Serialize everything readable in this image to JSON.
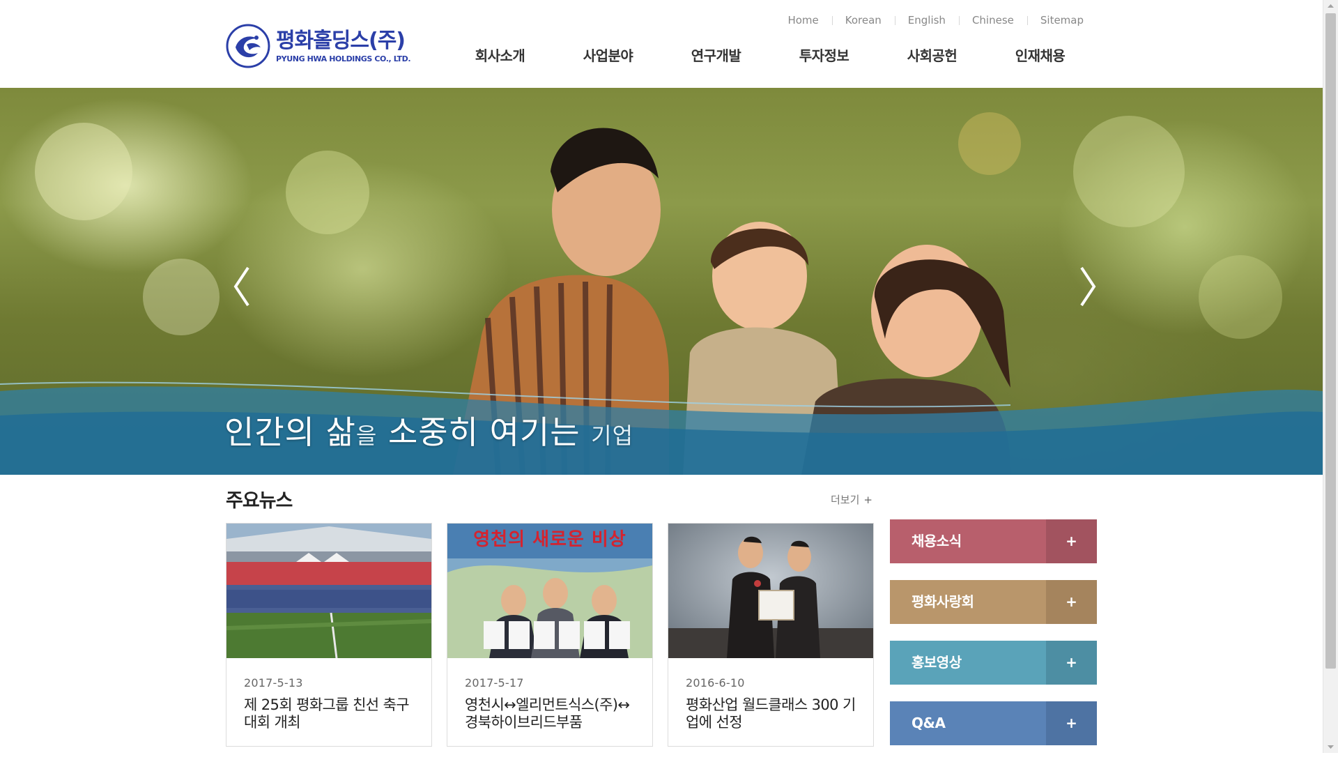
{
  "header": {
    "logo": {
      "name_ko": "평화홀딩스(주)",
      "name_en": "PYUNG HWA HOLDINGS CO., LTD."
    },
    "util_links": [
      "Home",
      "Korean",
      "English",
      "Chinese",
      "Sitemap"
    ],
    "gnb": [
      "회사소개",
      "사업분야",
      "연구개발",
      "투자정보",
      "사회공헌",
      "인재채용"
    ]
  },
  "hero": {
    "slogan_parts": [
      "인간의 삶",
      "을",
      " 소중히 여기는 ",
      "기업"
    ]
  },
  "news": {
    "title": "주요뉴스",
    "more_label": "더보기",
    "more_icon": "+",
    "items": [
      {
        "date": "2017-5-13",
        "title": "제 25회 평화그룹 친선 축구대회 개최",
        "image": "stadium-group-photo"
      },
      {
        "date": "2017-5-17",
        "title": "영천시↔엘리먼트식스(주)↔경북하이브리드부품",
        "image": "signing-ceremony-photo",
        "image_banner": "영천의 새로운 비상"
      },
      {
        "date": "2016-6-10",
        "title": "평화산업 월드클래스 300 기업에 선정",
        "image": "award-ceremony-photo"
      }
    ]
  },
  "quick_links": [
    {
      "label": "채용소식",
      "icon": "+",
      "color": "#b85f6c",
      "color_dark": "#a2535f"
    },
    {
      "label": "평화사랑회",
      "icon": "+",
      "color": "#b9966b",
      "color_dark": "#a5845d"
    },
    {
      "label": "홍보영상",
      "icon": "+",
      "color": "#5aa3b9",
      "color_dark": "#4d8ea3"
    },
    {
      "label": "Q&A",
      "icon": "+",
      "color": "#5a83b7",
      "color_dark": "#4e73a3"
    }
  ]
}
